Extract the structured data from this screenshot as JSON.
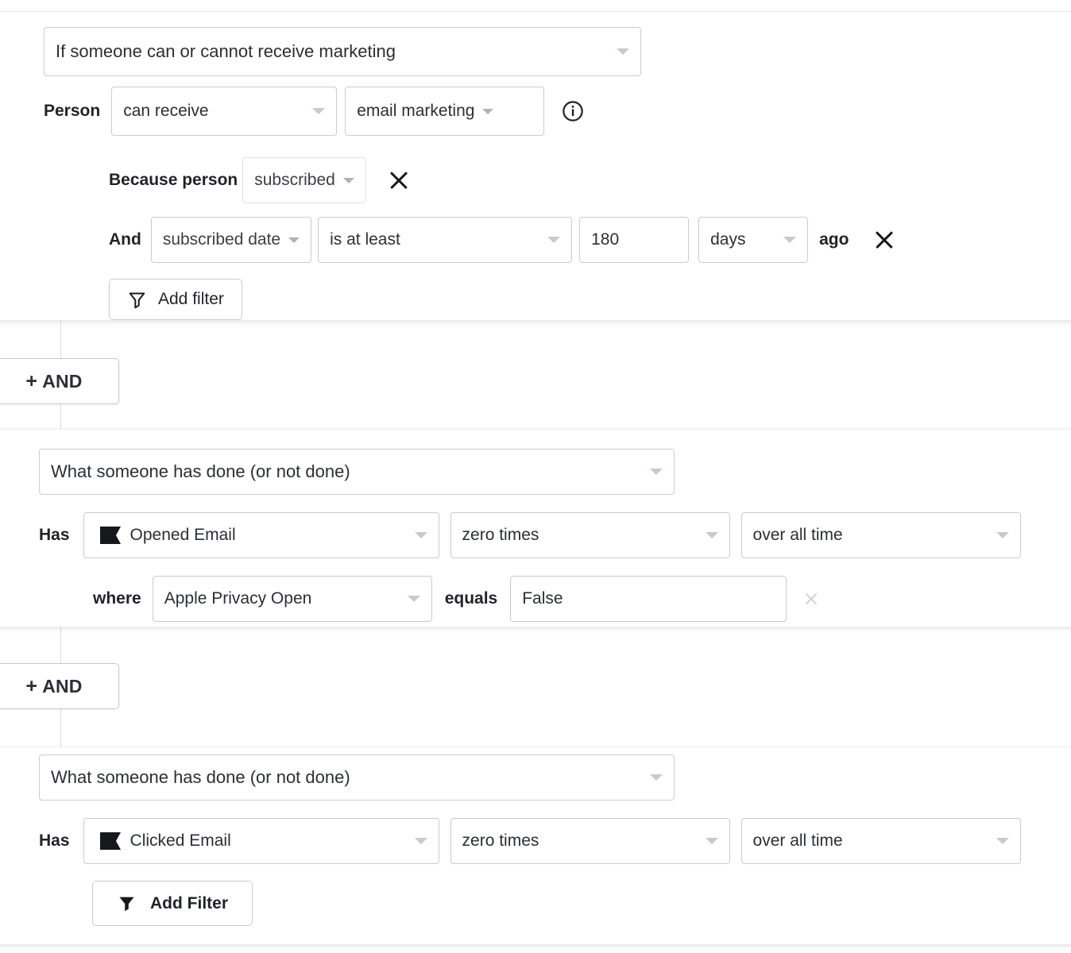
{
  "groups": [
    {
      "id": "group-1",
      "type_select": {
        "label": "If someone can or cannot receive marketing"
      },
      "person_row": {
        "prefix": "Person",
        "permission": "can receive",
        "channel": "email marketing",
        "info_icon": "info-circle-icon"
      },
      "reason_row": {
        "prefix": "Because person",
        "value": "subscribed",
        "remove_icon": "close-icon"
      },
      "date_row": {
        "prefix": "And",
        "property": "subscribed date",
        "operator": "is at least",
        "amount": "180",
        "unit": "days",
        "suffix": "ago",
        "remove_icon": "close-icon"
      },
      "add_filter": {
        "label": "Add filter",
        "icon": "funnel-outline-icon"
      }
    },
    {
      "id": "group-2",
      "type_select": {
        "label": "What someone has done (or not done)"
      },
      "metric_row": {
        "prefix": "Has",
        "event": "Opened Email",
        "event_icon": "flag-icon",
        "frequency": "zero times",
        "timeframe": "over all time"
      },
      "filter_row": {
        "prefix": "where",
        "property": "Apple Privacy Open",
        "operator": "equals",
        "value": "False",
        "remove_icon": "close-icon"
      }
    },
    {
      "id": "group-3",
      "type_select": {
        "label": "What someone has done (or not done)"
      },
      "metric_row": {
        "prefix": "Has",
        "event": "Clicked Email",
        "event_icon": "flag-icon",
        "frequency": "zero times",
        "timeframe": "over all time"
      },
      "add_filter": {
        "label": "Add Filter",
        "icon": "funnel-filled-icon"
      }
    }
  ],
  "connectors": [
    {
      "id": "and-1",
      "label": "AND",
      "plus": "+"
    },
    {
      "id": "and-2",
      "label": "AND",
      "plus": "+"
    }
  ],
  "colors": {
    "card_border": "#eceef0",
    "field_border": "#c8ccd0",
    "text": "#2b2f33",
    "label": "#1f2328",
    "caret": "#c6cace",
    "rail": "#d8dce0"
  }
}
